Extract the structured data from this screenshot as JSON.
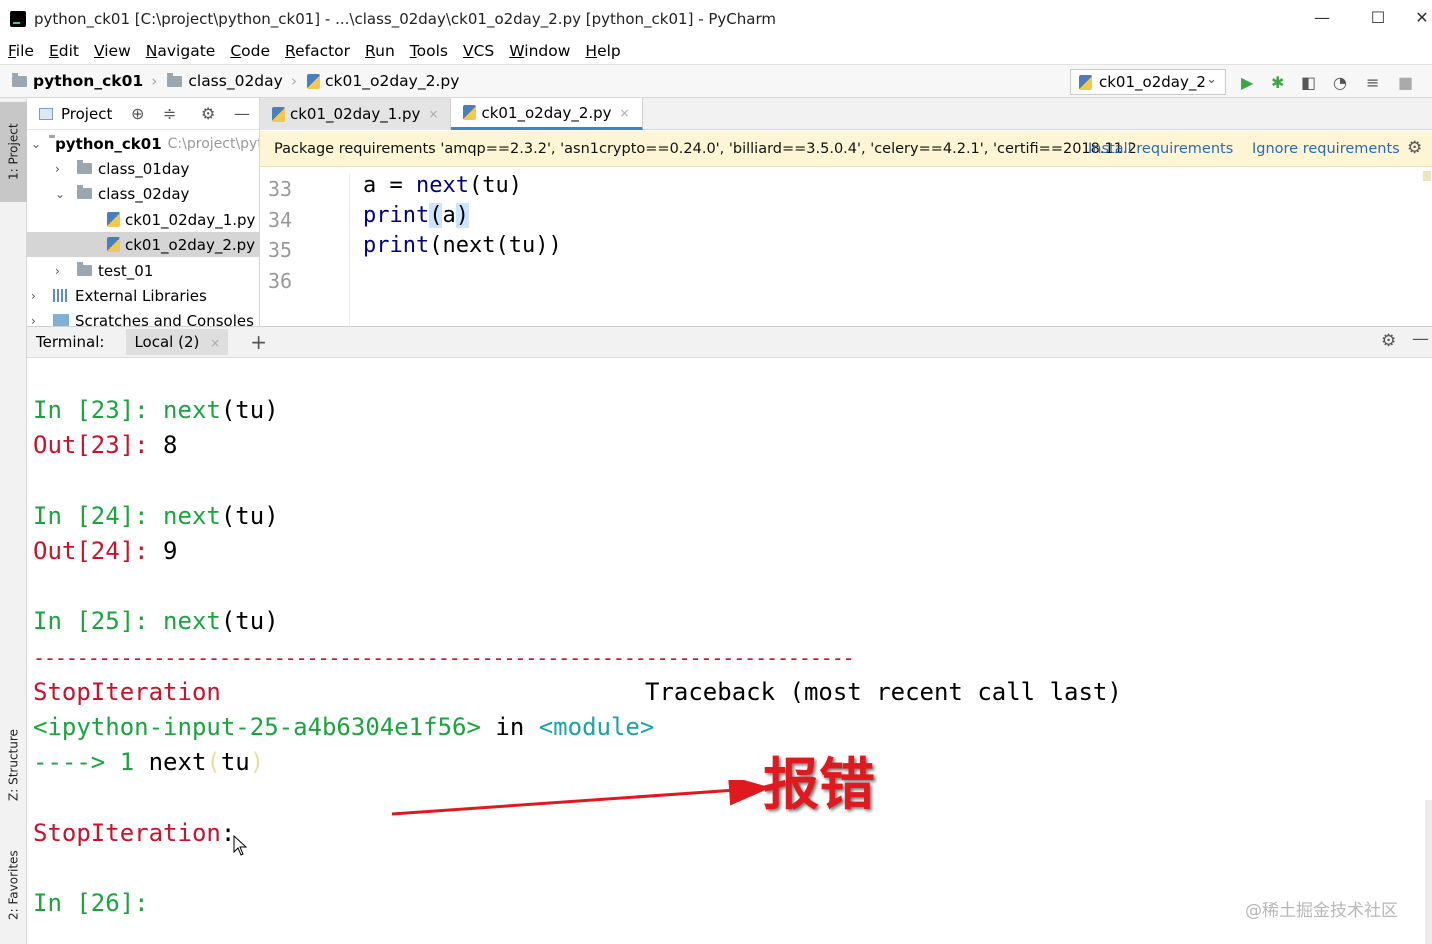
{
  "window": {
    "title": "python_ck01 [C:\\project\\python_ck01] - ...\\class_02day\\ck01_o2day_2.py [python_ck01] - PyCharm",
    "minimize": "—",
    "maximize": "☐",
    "close": "✕"
  },
  "menu": [
    "File",
    "Edit",
    "View",
    "Navigate",
    "Code",
    "Refactor",
    "Run",
    "Tools",
    "VCS",
    "Window",
    "Help"
  ],
  "breadcrumb": {
    "project": "python_ck01",
    "folder": "class_02day",
    "file": "ck01_o2day_2.py",
    "separator": "›"
  },
  "run_config": {
    "label": "ck01_o2day_2",
    "chevron": "⌄"
  },
  "toolbar_icons": [
    "run-icon",
    "debug-icon",
    "coverage-icon",
    "profile-icon",
    "concurrency-icon",
    "stop-icon"
  ],
  "left_strip": {
    "project_tab": "1: Project",
    "structure_tab": "Z: Structure",
    "favorites_tab": "2: Favorites"
  },
  "project_panel": {
    "title": "Project",
    "tree": [
      {
        "label": "python_ck01",
        "hint": "C:\\project\\python_ck01",
        "arrow": "⌄"
      },
      {
        "label": "class_01day",
        "arrow": "›"
      },
      {
        "label": "class_02day",
        "arrow": "⌄"
      },
      {
        "label": "ck01_02day_1.py"
      },
      {
        "label": "ck01_o2day_2.py"
      },
      {
        "label": "test_01",
        "arrow": "›"
      },
      {
        "label": "External Libraries",
        "arrow": "›"
      },
      {
        "label": "Scratches and Consoles",
        "arrow": "›"
      }
    ]
  },
  "editor_tabs": [
    {
      "label": "ck01_02day_1.py",
      "close": "×"
    },
    {
      "label": "ck01_o2day_2.py",
      "close": "×"
    }
  ],
  "banner": {
    "text": "Package requirements 'amqp==2.3.2', 'asn1crypto==0.24.0', 'billiard==3.5.0.4', 'celery==4.2.1', 'certifi==2018.11.2",
    "install": "Install requirements",
    "ignore": "Ignore requirements"
  },
  "editor": {
    "line_numbers": [
      "33",
      "34",
      "35",
      "36"
    ],
    "lines": [
      {
        "pre": "a = ",
        "call": "next",
        "post": "(tu)"
      },
      {
        "pre": "",
        "call": "print",
        "paren_open": "(",
        "arg": "a",
        "paren_close": ")"
      },
      {
        "pre": "",
        "call": "print",
        "post": "(next(tu))"
      }
    ]
  },
  "terminal_header": {
    "label": "Terminal:",
    "tab": "Local (2)",
    "tab_close": "×",
    "add": "+"
  },
  "terminal": {
    "in23": "In [23]:",
    "cmd23": "next",
    "args23": "(tu)",
    "out23": "Out[23]:",
    "val23": "8",
    "in24": "In [24]:",
    "cmd24": "next",
    "args24": "(tu)",
    "out24": "Out[24]:",
    "val24": "9",
    "in25": "In [25]:",
    "cmd25": "next",
    "args25": "(tu)",
    "dashes": "---------------------------------------------------------------------------",
    "err_name": "StopIteration",
    "traceback": "Traceback (most recent call last)",
    "input_ref": "<ipython-input-25-a4b6304e1f56>",
    "in_word": " in ",
    "module": "<module>",
    "arrow": "---->",
    "line_no": "1",
    "code_next": "next",
    "code_open": "(",
    "code_arg": "tu",
    "code_close": ")",
    "err_final": "StopIteration",
    "err_colon": ":",
    "in26": "In [26]:"
  },
  "annotation": "报错",
  "watermark": "@稀土掘金技术社区",
  "colors": {
    "accent_red": "#e0191e",
    "ipython_green": "#18a63c",
    "ipython_red": "#d0102a",
    "link_blue": "#2a6ab8"
  }
}
